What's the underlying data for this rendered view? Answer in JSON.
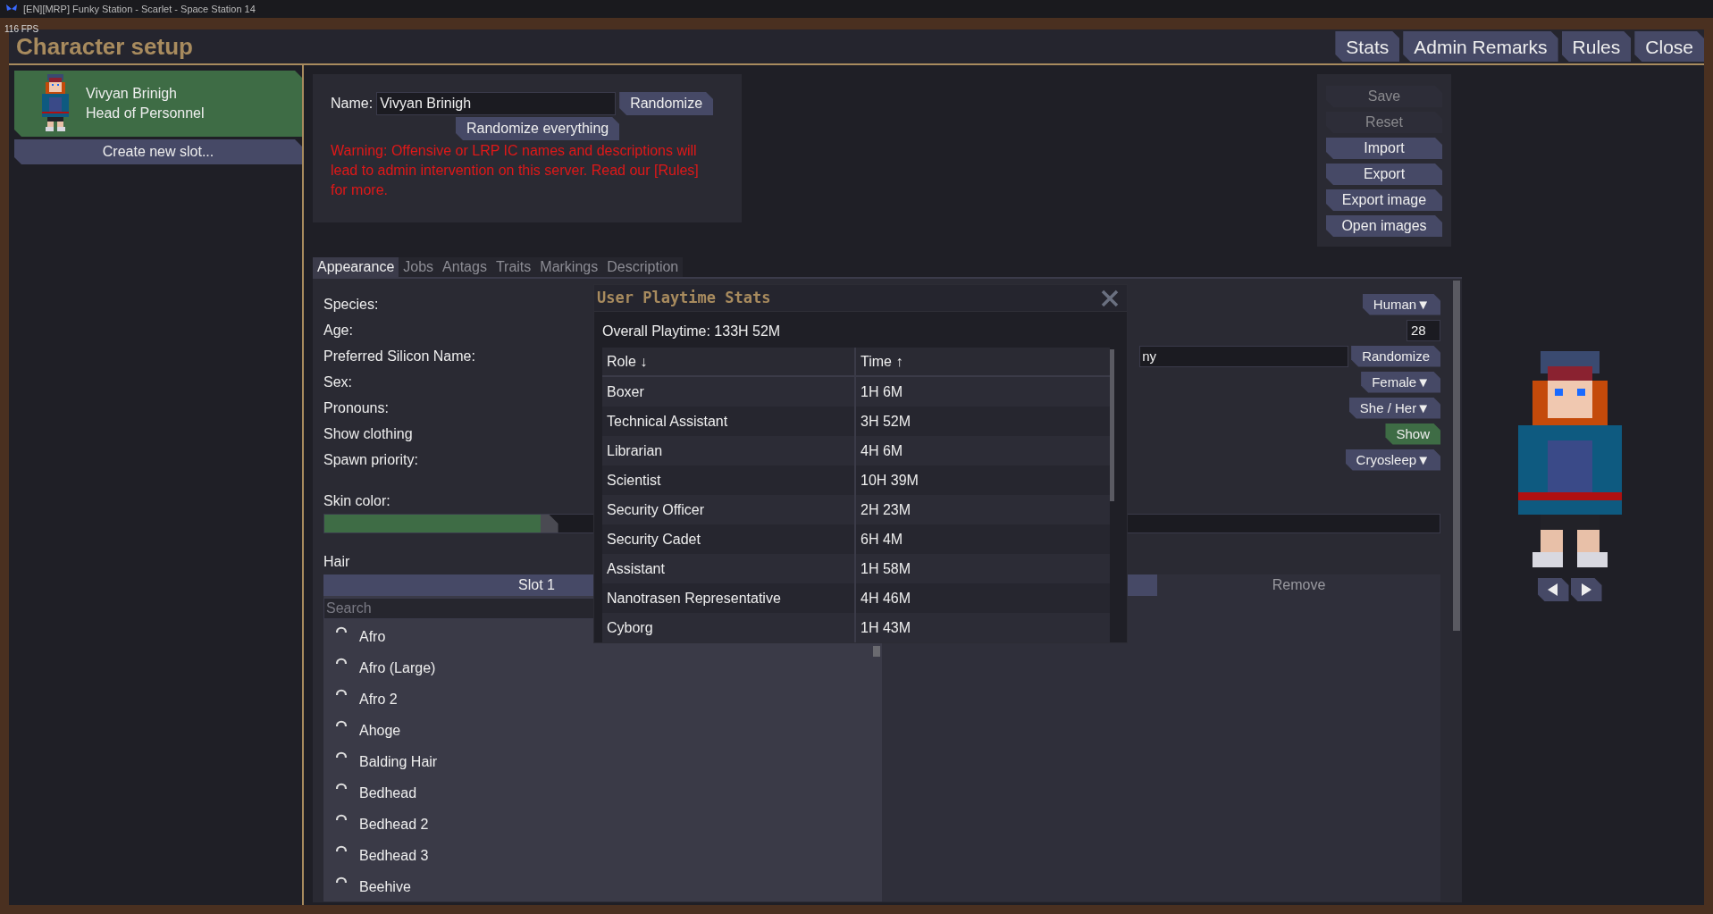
{
  "os_window": {
    "title": "[EN][MRP] Funky Station - Scarlet - Space Station 14"
  },
  "fps": "116 FPS",
  "header": {
    "title": "Character setup",
    "buttons": [
      "Stats",
      "Admin Remarks",
      "Rules",
      "Close"
    ]
  },
  "slots": [
    {
      "name": "Vivyan Brinigh",
      "job": "Head of Personnel",
      "selected": true
    }
  ],
  "create_slot": "Create new slot...",
  "name_panel": {
    "label": "Name:",
    "value": "Vivyan Brinigh",
    "randomize": "Randomize",
    "randomize_all": "Randomize everything",
    "warning": "Warning: Offensive or LRP IC names and descriptions will lead to admin intervention on this server. Read our [Rules] for more."
  },
  "actions": [
    {
      "label": "Save",
      "disabled": true
    },
    {
      "label": "Reset",
      "disabled": true
    },
    {
      "label": "Import",
      "disabled": false
    },
    {
      "label": "Export",
      "disabled": false
    },
    {
      "label": "Export image",
      "disabled": false
    },
    {
      "label": "Open images",
      "disabled": false
    }
  ],
  "tabs": [
    {
      "label": "Appearance",
      "selected": true
    },
    {
      "label": "Jobs",
      "selected": false
    },
    {
      "label": "Antags",
      "selected": false
    },
    {
      "label": "Traits",
      "selected": false
    },
    {
      "label": "Markings",
      "selected": false
    },
    {
      "label": "Description",
      "selected": false
    }
  ],
  "form": {
    "rows": [
      {
        "label": "Species:",
        "kind": "dropdown",
        "value": "Human▼"
      },
      {
        "label": "Age:",
        "kind": "input",
        "value": "28"
      },
      {
        "label": "Preferred Silicon Name:",
        "kind": "input_button",
        "value": "ny",
        "button": "Randomize"
      },
      {
        "label": "Sex:",
        "kind": "dropdown",
        "value": "Female▼"
      },
      {
        "label": "Pronouns:",
        "kind": "dropdown",
        "value": "She / Her▼"
      },
      {
        "label": "Show clothing",
        "kind": "toggle",
        "value": "Show",
        "on": true
      },
      {
        "label": "Spawn priority:",
        "kind": "dropdown",
        "value": "Cryosleep▼"
      }
    ]
  },
  "skin_color": {
    "label": "Skin color:",
    "level": 0.2
  },
  "hair": {
    "label": "Hair",
    "slots": [
      {
        "label": "Slot 1",
        "selected": true
      }
    ],
    "remove": "Remove",
    "search_placeholder": "Search",
    "styles": [
      "Afro",
      "Afro (Large)",
      "Afro 2",
      "Ahoge",
      "Balding Hair",
      "Bedhead",
      "Bedhead 2",
      "Bedhead 3",
      "Beehive"
    ]
  },
  "popup": {
    "title": "User Playtime Stats",
    "overall": "Overall Playtime: 133H 52M",
    "columns": [
      "Role ↓",
      "Time ↑"
    ],
    "rows": [
      [
        "Boxer",
        "1H 6M"
      ],
      [
        "Technical Assistant",
        "3H 52M"
      ],
      [
        "Librarian",
        "4H 6M"
      ],
      [
        "Scientist",
        "10H 39M"
      ],
      [
        "Security Officer",
        "2H 23M"
      ],
      [
        "Security Cadet",
        "6H 4M"
      ],
      [
        "Assistant",
        "1H 58M"
      ],
      [
        "Nanotrasen Representative",
        "4H 46M"
      ],
      [
        "Cyborg",
        "1H 43M"
      ]
    ]
  }
}
